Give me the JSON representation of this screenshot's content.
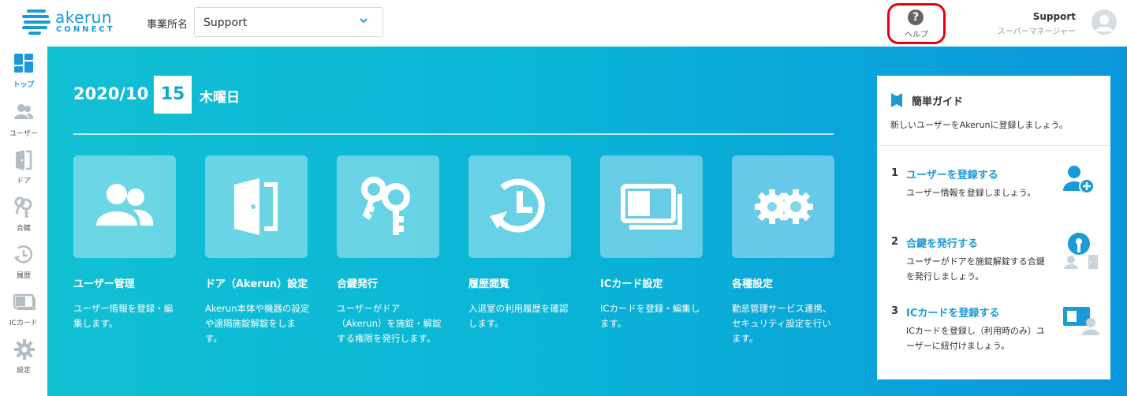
{
  "header": {
    "logo_main": "akerun",
    "logo_sub": "CONNECT",
    "office_label": "事業所名",
    "office_value": "Support",
    "help_label": "ヘルプ",
    "user_name": "Support",
    "user_role": "スーパーマネージャー"
  },
  "sidebar": {
    "items": [
      {
        "label": "トップ",
        "icon": "dashboard-icon",
        "active": true
      },
      {
        "label": "ユーザー",
        "icon": "users-icon"
      },
      {
        "label": "ドア",
        "icon": "door-icon"
      },
      {
        "label": "合鍵",
        "icon": "keys-icon"
      },
      {
        "label": "履歴",
        "icon": "history-icon"
      },
      {
        "label": "ICカード",
        "icon": "ic-card-icon"
      },
      {
        "label": "設定",
        "icon": "gear-icon"
      }
    ]
  },
  "date": {
    "year_month": "2020/10",
    "day": "15",
    "weekday": "木曜日"
  },
  "cards": [
    {
      "title": "ユーザー管理",
      "desc": "ユーザー情報を登録・編集します。",
      "icon": "users-icon"
    },
    {
      "title": "ドア（Akerun）設定",
      "desc": "Akerun本体や機器の設定や遠隔施錠解錠をします。",
      "icon": "door-icon"
    },
    {
      "title": "合鍵発行",
      "desc": "ユーザーがドア（Akerun）を施錠・解錠する権限を発行します。",
      "icon": "keys-icon"
    },
    {
      "title": "履歴閲覧",
      "desc": "入退室の利用履歴を確認します。",
      "icon": "history-icon"
    },
    {
      "title": "ICカード設定",
      "desc": "ICカードを登録・編集します。",
      "icon": "ic-card-icon"
    },
    {
      "title": "各種設定",
      "desc": "勤怠管理サービス連携、セキュリティ設定を行います。",
      "icon": "gear-icon"
    }
  ],
  "guide": {
    "title": "簡単ガイド",
    "subtitle": "新しいユーザーをAkerunに登録しましょう。",
    "steps": [
      {
        "num": "1",
        "title": "ユーザーを登録する",
        "desc": "ユーザー情報を登録しましょう。",
        "icon": "add-user-icon"
      },
      {
        "num": "2",
        "title": "合鍵を発行する",
        "desc": "ユーザーがドアを施錠解錠する合鍵を発行しましょう。",
        "icon": "key-user-icon"
      },
      {
        "num": "3",
        "title": "ICカードを登録する",
        "desc": "ICカードを登録し（利用時のみ）ユーザーに紐付けましょう。",
        "icon": "card-user-icon"
      }
    ]
  },
  "colors": {
    "accent": "#1a9ad6",
    "main_gradient_start": "#12c0d4",
    "main_gradient_end": "#0a98dc",
    "help_highlight": "#e60012"
  }
}
